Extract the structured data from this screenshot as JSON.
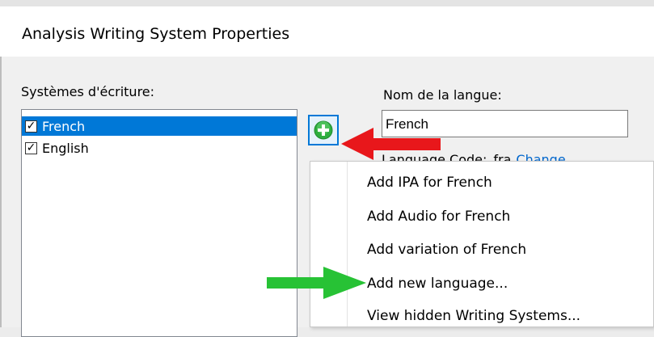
{
  "window": {
    "title": "Analysis Writing System Properties"
  },
  "writing_systems": {
    "label": "Systèmes d'écriture:",
    "items": [
      {
        "name": "French",
        "checked": true,
        "selected": true
      },
      {
        "name": "English",
        "checked": true,
        "selected": false
      }
    ]
  },
  "add_button": {
    "icon": "green-plus-icon",
    "color": "#2eae3f"
  },
  "language": {
    "name_label": "Nom de la langue:",
    "name_value": "French",
    "code_label": "Language Code:",
    "code_value": "fra",
    "change_link": "Change..."
  },
  "context_menu": {
    "items": [
      "Add IPA for French",
      "Add Audio for French",
      "Add variation of French",
      "Add new language...",
      "View hidden Writing Systems..."
    ]
  },
  "annotations": {
    "red_arrow_color": "#e8171b",
    "green_arrow_color": "#27c235"
  }
}
